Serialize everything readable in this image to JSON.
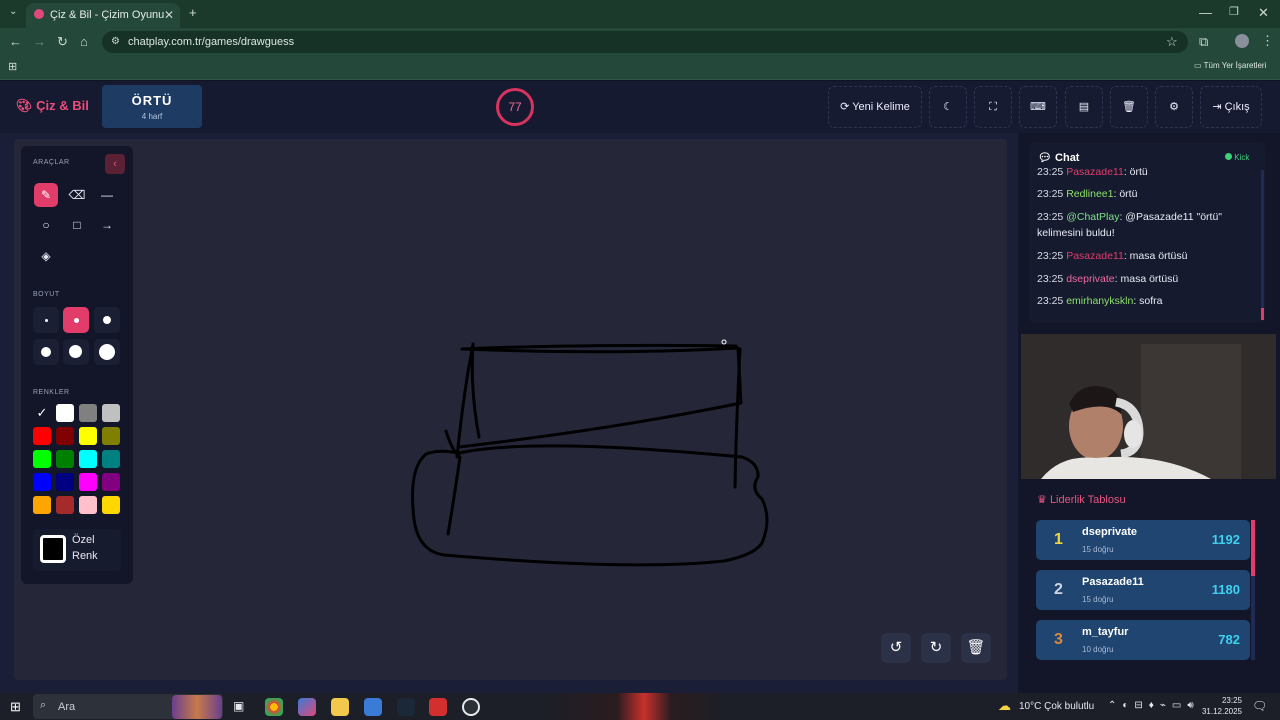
{
  "browser": {
    "tab_title": "Çiz & Bil - Çizim Oyunu",
    "url": "chatplay.com.tr/games/drawguess",
    "bookmarks_label": "Tüm Yer İşaretleri"
  },
  "header": {
    "logo": "Çiz & Bil",
    "word": "ÖRTÜ",
    "word_hint": "4 harf",
    "timer": "77",
    "new_word_label": "Yeni Kelime",
    "exit_label": "Çıkış"
  },
  "tools": {
    "tools_title": "ARAÇLAR",
    "size_title": "BOYUT",
    "colors_title": "RENKLER",
    "custom_color_label_1": "Özel",
    "custom_color_label_2": "Renk",
    "colors": [
      "#000000",
      "#ffffff",
      "#808080",
      "#c0c0c0",
      "#ff0000",
      "#800000",
      "#ffff00",
      "#808000",
      "#00ff00",
      "#008000",
      "#00ffff",
      "#008080",
      "#0000ff",
      "#000080",
      "#ff00ff",
      "#800080",
      "#ffa500",
      "#a52a2a",
      "#ffc0cb",
      "#ffd700"
    ]
  },
  "chat": {
    "title": "Chat",
    "platform": "Kick",
    "messages": [
      {
        "time": "23:25",
        "user": "Pasazade11",
        "text": ": örtü",
        "color": "#e23d6a"
      },
      {
        "time": "23:25",
        "user": "Redlinee1",
        "text": ": örtü",
        "color": "#8ce06a"
      },
      {
        "time": "23:25",
        "user": "@ChatPlay",
        "text": ": @Pasazade11 \"örtü\" kelimesini buldu!",
        "color": "#7fe08a"
      },
      {
        "time": "23:25",
        "user": "Pasazade11",
        "text": ": masa örtüsü",
        "color": "#e23d6a"
      },
      {
        "time": "23:25",
        "user": "dseprivate",
        "text": ": masa örtüsü",
        "color": "#f06aa0"
      },
      {
        "time": "23:25",
        "user": "emirhanykskln",
        "text": ": sofra",
        "color": "#8ce06a"
      }
    ]
  },
  "leaderboard": {
    "title": "Liderlik Tablosu",
    "players": [
      {
        "rank": "1",
        "name": "dseprivate",
        "correct": "15 doğru",
        "score": "1192",
        "rank_color": "#f5d442"
      },
      {
        "rank": "2",
        "name": "Pasazade11",
        "correct": "15 doğru",
        "score": "1180",
        "rank_color": "#d0d6e2"
      },
      {
        "rank": "3",
        "name": "m_tayfur",
        "correct": "10 doğru",
        "score": "782",
        "rank_color": "#d98a3a"
      }
    ]
  },
  "taskbar": {
    "search_placeholder": "Ara",
    "weather": "10°C  Çok bulutlu",
    "time": "23:25",
    "date": "31.12.2025"
  }
}
